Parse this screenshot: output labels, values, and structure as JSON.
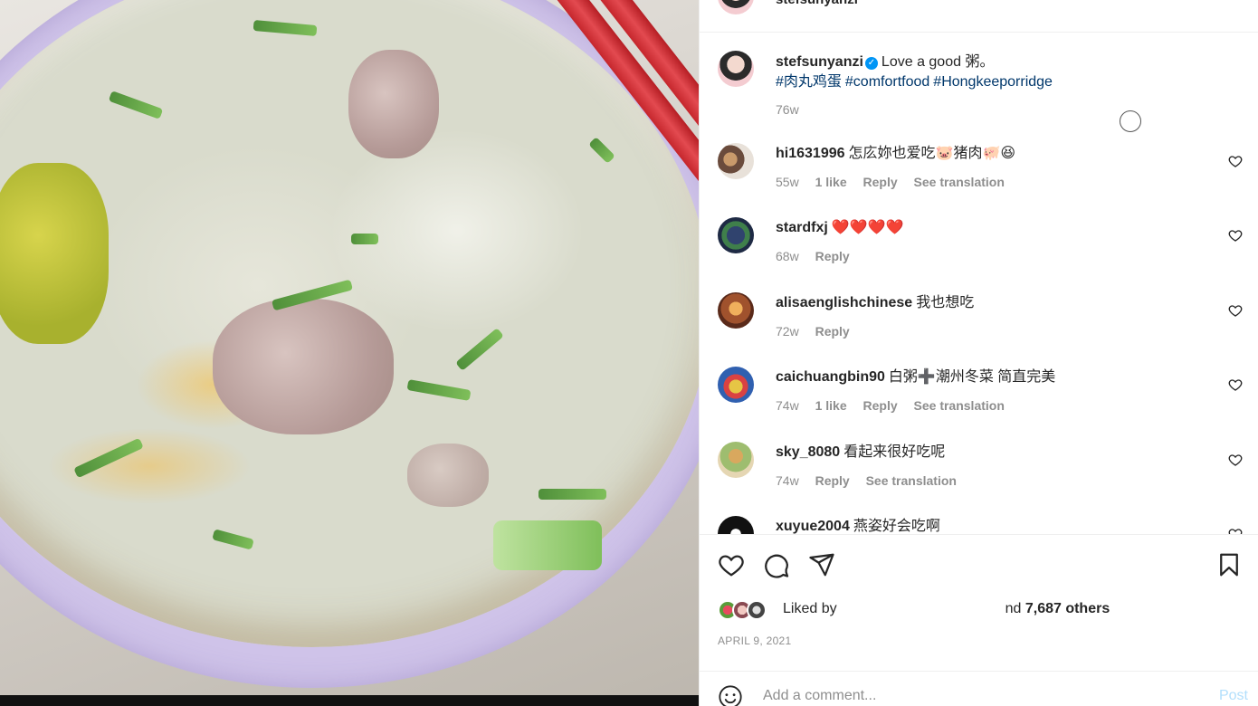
{
  "post_image": {
    "alt_subject": "porridge-photo"
  },
  "header": {
    "username": "stefsunyanzi"
  },
  "caption": {
    "username": "stefsunyanzi",
    "verified_mark": "✓",
    "text": "Love a good 粥。",
    "hashtags": [
      "#肉丸鸡蛋",
      "#comfortfood",
      "#Hongkeeporridge"
    ],
    "time": "76w"
  },
  "comments": [
    {
      "username": "hi1631996",
      "text": "怎庅妳也爱吃🐷猪肉🐖😆",
      "time": "55w",
      "likes": "1 like",
      "reply": "Reply",
      "translate": "See translation"
    },
    {
      "username": "stardfxj",
      "text": "❤️❤️❤️❤️",
      "time": "68w",
      "likes": "",
      "reply": "Reply",
      "translate": ""
    },
    {
      "username": "alisaenglishchinese",
      "text": "我也想吃",
      "time": "72w",
      "likes": "",
      "reply": "Reply",
      "translate": ""
    },
    {
      "username": "caichuangbin90",
      "text": "白粥➕潮州冬菜 简直完美",
      "time": "74w",
      "likes": "1 like",
      "reply": "Reply",
      "translate": "See translation"
    },
    {
      "username": "sky_8080",
      "text": "看起来很好吃呢",
      "time": "74w",
      "likes": "",
      "reply": "Reply",
      "translate": "See translation"
    },
    {
      "username": "xuyue2004",
      "text": "燕姿好会吃啊",
      "time": "",
      "likes": "",
      "reply": "",
      "translate": ""
    }
  ],
  "footer": {
    "liked_by_prefix": "Liked by",
    "liked_by_suffix": "nd",
    "others": "7,687 others",
    "date": "APRIL 9, 2021",
    "comment_placeholder": "Add a comment...",
    "post_label": "Post"
  },
  "colors": {
    "link": "#00376b",
    "verified": "#0095f6",
    "muted": "#8e8e8e",
    "post_disabled": "#b2dffc",
    "heart_red": "#e0245e"
  },
  "icons": [
    "heart-icon",
    "comment-icon",
    "share-icon",
    "bookmark-icon",
    "smile-icon",
    "verified-icon"
  ]
}
